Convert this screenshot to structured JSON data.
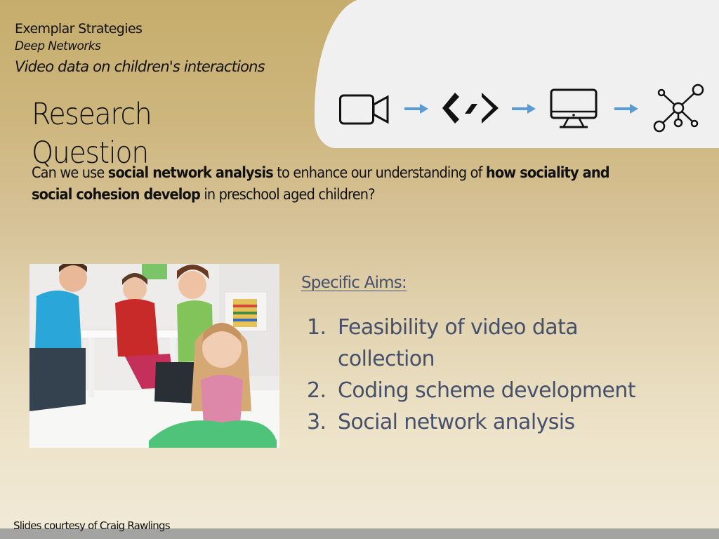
{
  "header": {
    "line1": "Exemplar Strategies",
    "line2": "Deep Networks",
    "line3": "Video data on children's interactions"
  },
  "pipeline": {
    "steps": [
      {
        "icon": "video-camera-icon",
        "label": "Video"
      },
      {
        "icon": "code-icon",
        "label": "Code"
      },
      {
        "icon": "computer-monitor-icon",
        "label": "Computer"
      },
      {
        "icon": "network-graph-icon",
        "label": "Network"
      }
    ],
    "arrow_color": "#5b9bd5"
  },
  "title": {
    "line1": "Research",
    "line2": "Question"
  },
  "question": {
    "part1": "Can we use ",
    "bold1": "social network analysis",
    "part2": " to enhance our understanding of ",
    "bold2": "how sociality and social cohesion develop",
    "part3": " in preschool aged children?"
  },
  "photo": {
    "description": "Children playing at a table with a sad girl sitting apart in the foreground"
  },
  "aims": {
    "heading": "Specific Aims:",
    "items": [
      {
        "num": "1.",
        "text": "Feasibility of video data collection"
      },
      {
        "num": "2.",
        "text": "Coding scheme development"
      },
      {
        "num": "3.",
        "text": "Social network analysis"
      }
    ]
  },
  "footer": {
    "credit": "Slides courtesy of Craig Rawlings"
  },
  "colors": {
    "background_top": "#c6ad6d",
    "background_bottom": "#f1ead7",
    "panel": "#f0f0f0",
    "aims_text": "#46506a",
    "bottom_bar": "#a3a3a1"
  }
}
